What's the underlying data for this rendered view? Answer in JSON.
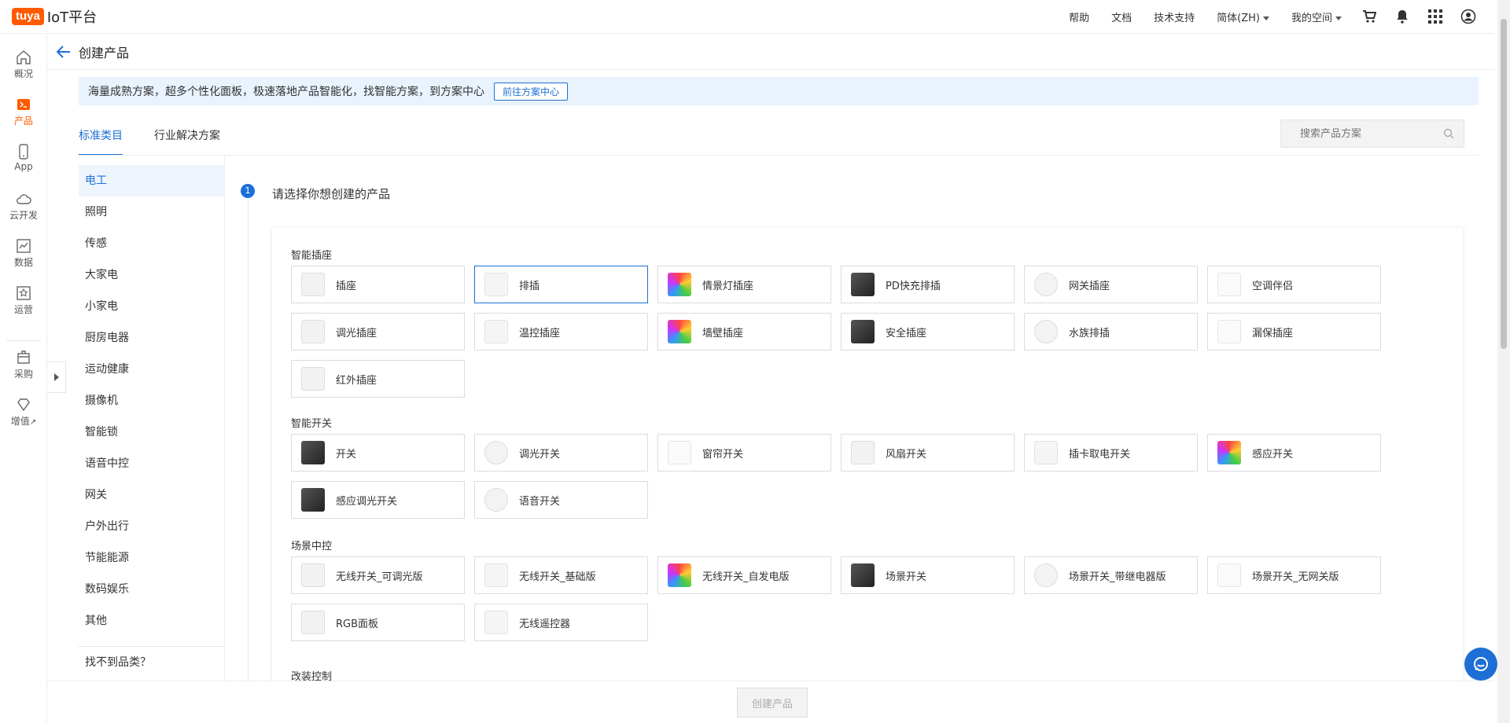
{
  "app": {
    "logo_badge": "tuya",
    "logo_text": "IoT平台"
  },
  "topbar": {
    "help": "帮助",
    "docs": "文档",
    "support": "技术支持",
    "language": "简体(ZH)",
    "my_space": "我的空间",
    "icons": [
      "cart-icon",
      "bell-icon",
      "apps-grid-icon",
      "user-avatar-icon"
    ]
  },
  "leftnav": {
    "items": [
      {
        "label": "概况",
        "icon": "home-icon"
      },
      {
        "label": "产品",
        "icon": "terminal-icon"
      },
      {
        "label": "App",
        "icon": "phone-icon"
      },
      {
        "label": "云开发",
        "icon": "cloud-icon"
      },
      {
        "label": "数据",
        "icon": "chart-icon"
      },
      {
        "label": "运营",
        "icon": "star-icon"
      },
      {
        "label": "采购",
        "icon": "box-icon"
      },
      {
        "label": "增值",
        "icon": "diamond-icon"
      }
    ]
  },
  "header": {
    "title": "创建产品"
  },
  "banner": {
    "text": "海量成熟方案，超多个性化面板，极速落地产品智能化，找智能方案，到方案中心",
    "button": "前往方案中心"
  },
  "tabs": [
    {
      "label": "标准类目",
      "active": true
    },
    {
      "label": "行业解决方案",
      "active": false
    }
  ],
  "search": {
    "placeholder": "搜索产品方案"
  },
  "categories": [
    "电工",
    "照明",
    "传感",
    "大家电",
    "小家电",
    "厨房电器",
    "运动健康",
    "摄像机",
    "智能锁",
    "语音中控",
    "网关",
    "户外出行",
    "节能能源",
    "数码娱乐",
    "其他"
  ],
  "category_missing": "找不到品类？",
  "step": {
    "number": "1",
    "title": "请选择你想创建的产品"
  },
  "sections": [
    {
      "title": "智能插座",
      "items": [
        "插座",
        "排插",
        "情景灯插座",
        "PD快充排插",
        "网关插座",
        "空调伴侣",
        "调光插座",
        "温控插座",
        "墙壁插座",
        "安全插座",
        "水族排插",
        "漏保插座",
        "红外插座"
      ]
    },
    {
      "title": "智能开关",
      "items": [
        "开关",
        "调光开关",
        "窗帘开关",
        "风扇开关",
        "插卡取电开关",
        "感应开关",
        "感应调光开关",
        "语音开关"
      ]
    },
    {
      "title": "场景中控",
      "items": [
        "无线开关_可调光版",
        "无线开关_基础版",
        "无线开关_自发电版",
        "场景开关",
        "场景开关_带继电器版",
        "场景开关_无网关版",
        "RGB面板",
        "无线遥控器"
      ]
    },
    {
      "title": "改装控制",
      "items": []
    }
  ],
  "footer": {
    "create_button": "创建产品"
  },
  "colors": {
    "brand": "#ff5a00",
    "accent": "#1d6fd6",
    "banner_bg": "#e8f3fd"
  }
}
